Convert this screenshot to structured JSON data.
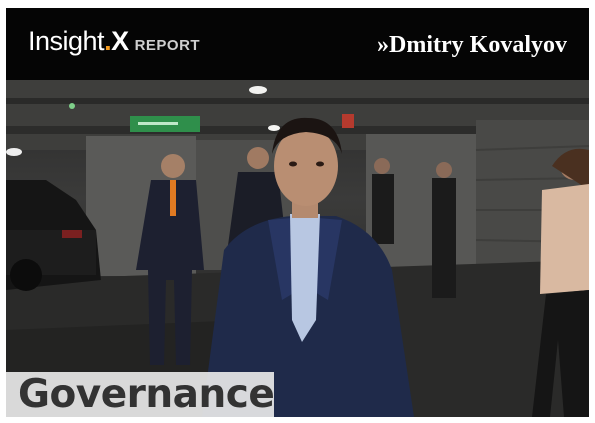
{
  "header": {
    "brand_insight": "Insight",
    "brand_dot": ".",
    "brand_x": "X",
    "brand_report": "REPORT",
    "author": "»Dmitry Kovalyov"
  },
  "photo": {
    "sign_text": "",
    "caption": "Governance"
  },
  "colors": {
    "accent": "#f39a1e",
    "header_bg": "#050505",
    "caption_bg": "#ececec"
  }
}
